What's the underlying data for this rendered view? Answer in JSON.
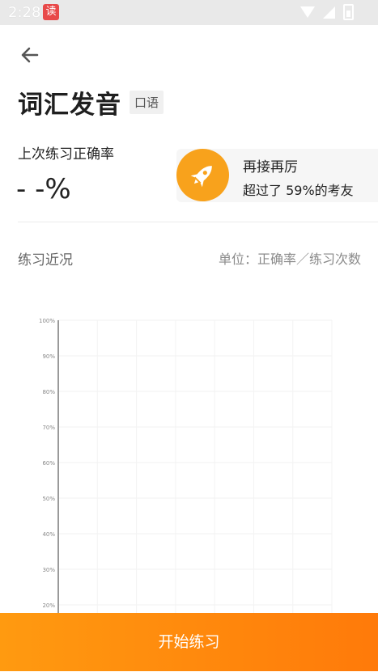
{
  "status_bar": {
    "time": "2:28",
    "app_icon_text": "读"
  },
  "header": {
    "title": "词汇发音",
    "tag": "口语"
  },
  "last_accuracy": {
    "label": "上次练习正确率",
    "value": "- -%"
  },
  "encouragement": {
    "line1": "再接再厉",
    "line2": "超过了 59%的考友",
    "icon": "rocket-icon",
    "icon_bg": "#f8a21c"
  },
  "practice": {
    "title": "练习近况",
    "unit": "单位：正确率／练习次数"
  },
  "chart_data": {
    "type": "line",
    "series": [],
    "y_ticks": [
      "100%",
      "90%",
      "80%",
      "70%",
      "60%",
      "50%",
      "40%",
      "30%",
      "20%"
    ],
    "ylim": [
      20,
      100
    ],
    "grid": true
  },
  "start_button": {
    "label": "开始练习",
    "gradient_from": "#ff9a10",
    "gradient_to": "#ff7a0a"
  }
}
